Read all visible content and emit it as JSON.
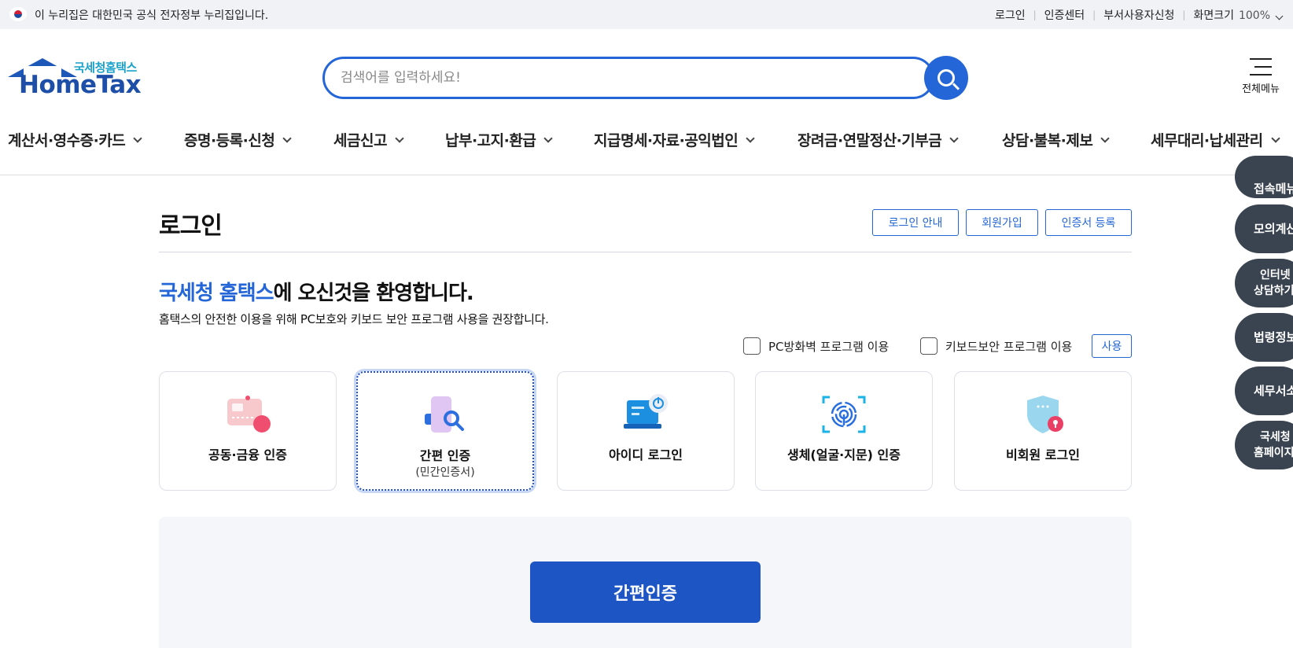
{
  "gov_bar": {
    "text": "이 누리집은 대한민국 공식 전자정부 누리집입니다.",
    "links": [
      "로그인",
      "인증센터",
      "부서사용자신청"
    ],
    "zoom_label": "화면크기",
    "zoom_value": "100%"
  },
  "header": {
    "logo_ko": "국세청홈택스",
    "logo_en": "HomeTax",
    "search_placeholder": "검색어를 입력하세요!",
    "all_menu_label": "전체메뉴"
  },
  "nav": {
    "items": [
      "계산서·영수증·카드",
      "증명·등록·신청",
      "세금신고",
      "납부·고지·환급",
      "지급명세·자료·공익법인",
      "장려금·연말정산·기부금",
      "상담·불복·제보",
      "세무대리·납세관리"
    ]
  },
  "quick_menu": [
    "접속메뉴",
    "모의계산",
    "인터넷\n상담하기",
    "법령정보",
    "세무서소개",
    "국세청\n홈페이지"
  ],
  "login": {
    "title": "로그인",
    "buttons": [
      "로그인 안내",
      "회원가입",
      "인증서 등록"
    ],
    "welcome_highlight": "국세청 홈택스",
    "welcome_rest": "에 오신것을 환영합니다.",
    "welcome_sub": "홈택스의 안전한 이용을 위해 PC보호와 키보드 보안 프로그램 사용을 권장합니다.",
    "option_firewall": "PC방화벽 프로그램 이용",
    "option_keyboard": "키보드보안 프로그램 이용",
    "option_use_button": "사용",
    "methods": [
      {
        "label": "공동·금융 인증",
        "sub": "",
        "icon": "certificate-card-icon"
      },
      {
        "label": "간편 인증",
        "sub": "(민간인증서)",
        "icon": "phone-search-icon"
      },
      {
        "label": "아이디 로그인",
        "sub": "",
        "icon": "laptop-power-icon"
      },
      {
        "label": "생체(얼굴·지문) 인증",
        "sub": "",
        "icon": "fingerprint-icon"
      },
      {
        "label": "비회원 로그인",
        "sub": "",
        "icon": "shield-lock-icon"
      }
    ],
    "selected_method": 1,
    "submit_label": "간편인증"
  },
  "colors": {
    "primary": "#2466d8",
    "submit": "#1d55c5",
    "quick_bg": "#3a4350"
  }
}
